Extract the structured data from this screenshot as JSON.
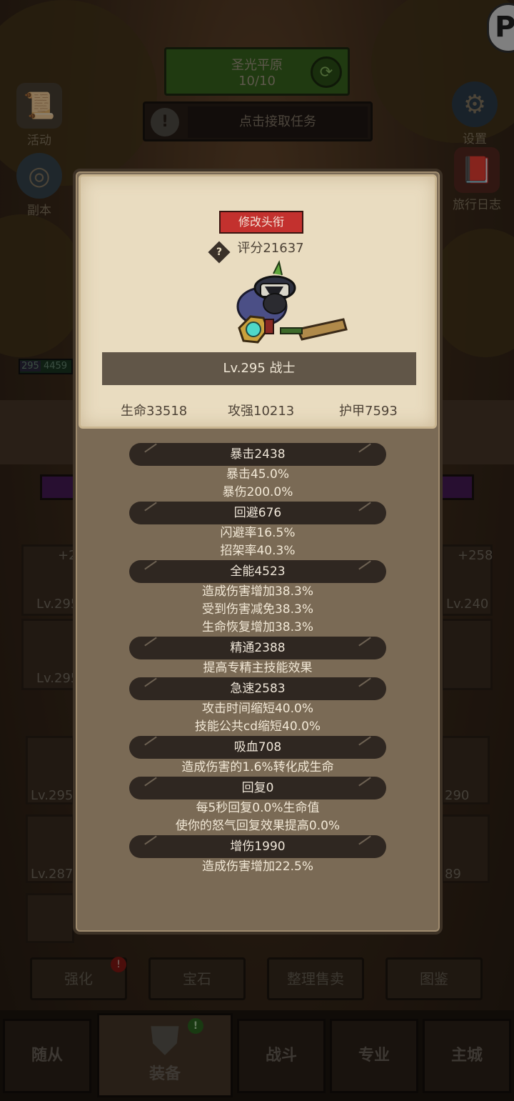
{
  "background": {
    "zone": {
      "name": "圣光平原",
      "progress": "10/10"
    },
    "task_prompt": "点击接取任务",
    "left_buttons": [
      {
        "label": "活动",
        "icon": "activity-scroll-icon"
      },
      {
        "label": "副本",
        "icon": "dungeon-portal-icon"
      }
    ],
    "right_buttons": [
      {
        "label": "设置",
        "icon": "gear-icon"
      },
      {
        "label": "旅行日志",
        "icon": "journal-book-icon"
      }
    ],
    "player_bar": {
      "level": "295",
      "hp": "4459"
    },
    "equip_levels": [
      "Lv.295",
      "Lv.295",
      "Lv.295",
      "Lv.287",
      "Lv.240",
      "290",
      "89"
    ],
    "equip_bonus": [
      "+2",
      "+258"
    ],
    "bottom_tabs": [
      {
        "label": "强化",
        "badge": "!"
      },
      {
        "label": "宝石"
      },
      {
        "label": "整理售卖"
      },
      {
        "label": "图鉴"
      }
    ],
    "nav": [
      {
        "label": "随从"
      },
      {
        "label": "装备",
        "badge": "!",
        "active": true
      },
      {
        "label": "战斗"
      },
      {
        "label": "专业"
      },
      {
        "label": "主城"
      }
    ]
  },
  "panel": {
    "title_button": "修改头衔",
    "score": "评分21637",
    "level_class": "Lv.295 战士",
    "main_stats": {
      "hp": "生命33518",
      "attack": "攻强10213",
      "armor": "护甲7593"
    },
    "stats": [
      {
        "head": "暴击2438",
        "lines": [
          "暴击45.0%",
          "暴伤200.0%"
        ]
      },
      {
        "head": "回避676",
        "lines": [
          "闪避率16.5%",
          "招架率40.3%"
        ]
      },
      {
        "head": "全能4523",
        "lines": [
          "造成伤害增加38.3%",
          "受到伤害减免38.3%",
          "生命恢复增加38.3%"
        ]
      },
      {
        "head": "精通2388",
        "lines": [
          "提高专精主技能效果"
        ]
      },
      {
        "head": "急速2583",
        "lines": [
          "攻击时间缩短40.0%",
          "技能公共cd缩短40.0%"
        ]
      },
      {
        "head": "吸血708",
        "lines": [
          "造成伤害的1.6%转化成生命"
        ]
      },
      {
        "head": "回复0",
        "lines": [
          "每5秒回复0.0%生命值",
          "使你的怒气回复效果提高0.0%"
        ]
      },
      {
        "head": "增伤1990",
        "lines": [
          "造成伤害增加22.5%"
        ]
      }
    ]
  },
  "colors": {
    "title_button": "#c3312e",
    "panel_card": "#e9dcc0",
    "stat_header": "#2f2721",
    "panel_body": "#7a6a55"
  }
}
